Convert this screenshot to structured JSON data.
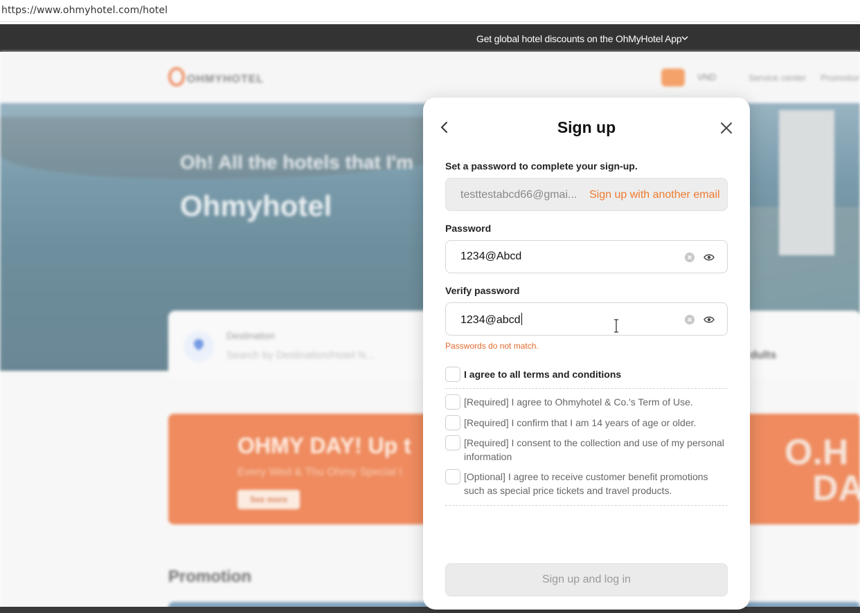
{
  "browser": {
    "url": "https://www.ohmyhotel.com/hotel"
  },
  "top_promo": {
    "text": "Get global hotel discounts on the OhMyHotel App",
    "icon": "chevron-down-icon"
  },
  "header": {
    "logo": "OHMYHOTEL",
    "currency": "VND",
    "nav": [
      "Service center",
      "Promotion"
    ]
  },
  "hero": {
    "tagline": "Oh! All the hotels that I'm",
    "title": "Ohmyhotel",
    "search": {
      "destination_label": "Destination",
      "destination_placeholder": "Search by Destination/Hotel N...",
      "guests_text": "dults"
    }
  },
  "banner": {
    "title": "OHMY DAY! Up t",
    "subtitle": "Every Wed & Thu Ohmy Special I",
    "button": "See more",
    "logo_text_1": "O.H",
    "logo_text_2": "DA"
  },
  "promotion": {
    "heading": "Promotion"
  },
  "modal": {
    "title": "Sign up",
    "subtitle": "Set a password to complete your sign-up.",
    "email_value": "testtestabcd66@gmai...",
    "email_alt_link": "Sign up with another email",
    "password_label": "Password",
    "password_value": "1234@Abcd",
    "verify_label": "Verify password",
    "verify_value": "1234@abcd",
    "error": "Passwords do not match.",
    "agree_all": "I agree to all terms and conditions",
    "terms": [
      "[Required] I agree to Ohmyhotel & Co.'s Term of Use.",
      "[Required] I confirm that I am 14 years of age or older.",
      "[Required] I consent to the collection and use of my personal information",
      "[Optional] I agree to receive customer benefit promotions such as special price tickets and travel products."
    ],
    "submit": "Sign up and log in"
  },
  "colors": {
    "accent": "#ee7a2e",
    "error": "#e06a2c",
    "dark_bar": "#333333"
  }
}
